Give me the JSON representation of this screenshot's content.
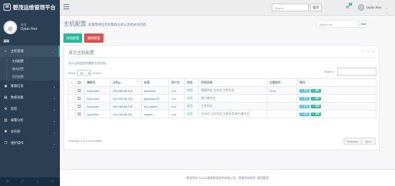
{
  "brand": {
    "logo": "M",
    "title": "碧茂运维管理平台"
  },
  "profile": {
    "welcome": "欢迎,",
    "name": "Dylan Ren"
  },
  "sidebar": {
    "section": "基础",
    "menus": [
      {
        "icon": "home-icon",
        "glyph": "⌂",
        "label": "主机管理",
        "active": true,
        "sub": [
          {
            "label": "主机配置",
            "current": true
          },
          {
            "label": "服务配置"
          },
          {
            "label": "项目配置"
          }
        ]
      },
      {
        "icon": "eye-icon",
        "glyph": "◉",
        "label": "集群信息"
      },
      {
        "icon": "database-icon",
        "glyph": "▤",
        "label": "数据采集"
      },
      {
        "icon": "cogs-icon",
        "glyph": "⚙",
        "label": "巡检"
      },
      {
        "icon": "chart-icon",
        "glyph": "▥",
        "label": "报警分析"
      },
      {
        "icon": "bug-icon",
        "glyph": "✱",
        "label": "发布库"
      },
      {
        "icon": "clone-icon",
        "glyph": "❐",
        "label": "维护操作"
      }
    ],
    "footer_icons": [
      "settings-icon",
      "fullscreen-icon",
      "lock-icon",
      "logout-icon"
    ],
    "footer_glyphs": [
      "⚙",
      "⤢",
      "◑",
      "⏻"
    ]
  },
  "topnav": {
    "search_placeholder": "Search",
    "submit_label": "提交",
    "badge_count": "6",
    "username": "Dylan Ren"
  },
  "page": {
    "title": "主机配置",
    "subtitle": "配置需要监控的集群主机以及相关的内容",
    "search_placeholder": "Search for...",
    "go_label": "Go!",
    "add_button": "添加配置",
    "delete_button": "删除配置"
  },
  "panel": {
    "title": "显示主机配置",
    "description": "显示当前监控的集群主机信息。",
    "show_label": "Show",
    "show_value": "10",
    "entries_label": "entries",
    "search_label": "Search:",
    "columns": [
      "集群名",
      "主机ip",
      "标签",
      "用户名",
      "状态",
      "所有系统",
      "主要软件",
      "操作"
    ],
    "rows": [
      {
        "cluster": "mycluster",
        "ip": "192.168.86.120",
        "tag": "synctest1",
        "user": "root",
        "status": "启用",
        "systems": "管理节点,主节点,工作节点",
        "software": "None"
      },
      {
        "cluster": "mycluster",
        "ip": "192.168.86.130",
        "tag": "gateway130",
        "user": "root",
        "status": "启用",
        "systems": "客户端节点",
        "software": ""
      },
      {
        "cluster": "mycluster",
        "ip": "192.168.86.232",
        "tag": "my_slave1",
        "user": "root",
        "status": "启用",
        "systems": "工作节点",
        "software": ""
      },
      {
        "cluster": "sparkDev",
        "ip": "192.168.88.251",
        "tag": "master",
        "user": "root",
        "status": "启用",
        "systems": "主节点,工作节点,工具节点,客户端节点",
        "software": ""
      }
    ],
    "op_detail": "详情",
    "op_edit": "编辑",
    "info": "Showing 1 to 4 of 4 entries",
    "prev": "Previous",
    "next": "Next"
  },
  "footer": {
    "text": "版权所有 ©2018湖南碧茂软件有限公司。保留所有权利. 碧茂管理"
  },
  "colors": {
    "sidebar": "#2a3f54",
    "accent": "#26b99a",
    "danger": "#d9534f",
    "info": "#5bc0de"
  }
}
